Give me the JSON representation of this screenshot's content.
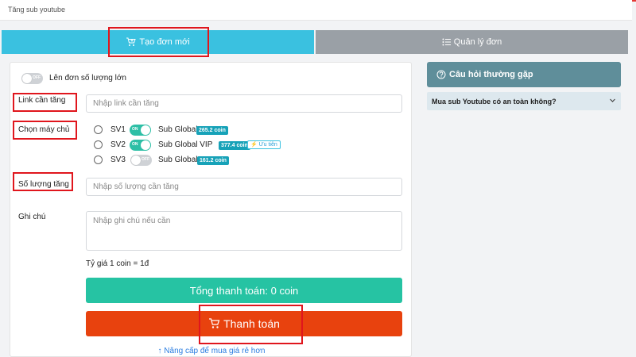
{
  "header": {
    "title": "Tăng sub youtube"
  },
  "tabs": [
    {
      "label": "Tạo đơn mới",
      "icon": "cart-plus-icon",
      "active": true
    },
    {
      "label": "Quản lý đơn",
      "icon": "list-icon",
      "active": false
    }
  ],
  "form": {
    "bulk_toggle": {
      "label": "Lên đơn số lượng lớn",
      "state": "OFF"
    },
    "link": {
      "label": "Link cần tăng",
      "placeholder": "Nhập link cần tăng"
    },
    "server": {
      "label": "Chọn máy chủ",
      "options": [
        {
          "code": "SV1",
          "toggle": "ON",
          "name": "Sub Global",
          "price": "265.2 coin",
          "tag": ""
        },
        {
          "code": "SV2",
          "toggle": "ON",
          "name": "Sub Global VIP",
          "price": "377.4 coin",
          "tag": "⚡ Ưu tiên"
        },
        {
          "code": "SV3",
          "toggle": "OFF",
          "name": "Sub Global",
          "price": "161.2 coin",
          "tag": ""
        }
      ]
    },
    "quantity": {
      "label": "Số lượng tăng",
      "placeholder": "Nhập số lượng cần tăng"
    },
    "note": {
      "label": "Ghi chú",
      "placeholder": "Nhập ghi chú nếu cần"
    },
    "rate": "Tỷ giá 1 coin = 1đ",
    "total_button": "Tổng thanh toán: 0 coin",
    "pay_button": "Thanh toán",
    "upgrade_link": "Nâng cấp để mua giá rẻ hơn"
  },
  "faq": {
    "title": "Câu hỏi thường gặp",
    "items": [
      {
        "question": "Mua sub Youtube có an toàn không?"
      }
    ]
  },
  "colors": {
    "tab_active": "#3ac1e0",
    "tab_inactive": "#9aa0a6",
    "total_button": "#26c3a3",
    "pay_button": "#e8420e",
    "badge": "#17a2b8",
    "faq_header": "#5f8e9a",
    "highlight": "#e0161d"
  }
}
